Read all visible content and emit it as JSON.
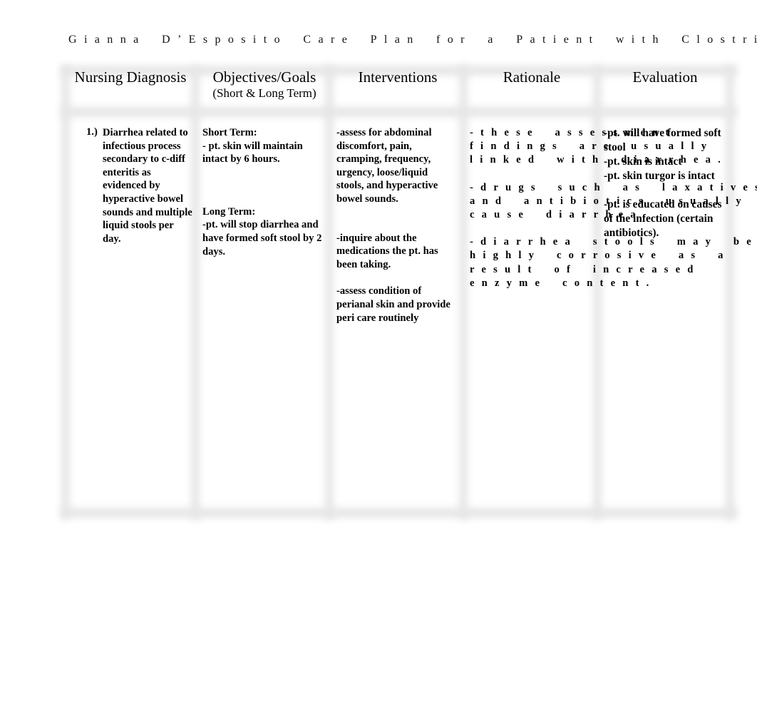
{
  "document": {
    "title": "Gianna D’Esposito Care Plan for a Patient with Clostridium d"
  },
  "table": {
    "headers": {
      "diagnosis": "Nursing Diagnosis",
      "objectives": "Objectives/Goals",
      "objectives_sub": "(Short & Long Term)",
      "interventions": "Interventions",
      "rationale": "Rationale",
      "evaluation": "Evaluation"
    },
    "row1": {
      "number": "1.)",
      "diagnosis": "Diarrhea related to infectious process secondary to c-diff enteritis as evidenced by hyperactive bowel sounds and multiple liquid stools per day.",
      "objectives": {
        "short_label": "Short Term:",
        "short_text": "- pt. skin will maintain intact by 6 hours.",
        "long_label": "Long Term:",
        "long_text": "-pt. will stop diarrhea and have formed soft stool by 2 days."
      },
      "interventions": [
        "-assess for abdominal discomfort, pain, cramping, frequency, urgency, loose/liquid stools, and hyperactive bowel sounds.",
        "-inquire about the medications the pt. has been taking.",
        "-assess condition of perianal skin and provide peri care routinely"
      ],
      "rationale": {
        "r1": [
          "-these assessment",
          "findings are usually",
          "linked with diarrhea."
        ],
        "r2": [
          "-drugs such as laxatives",
          "and antibiotics usually",
          "cause diarrhea."
        ],
        "r3": [
          "-diarrhea stools may be",
          "highly corrosive as a",
          "result of increased",
          "enzyme content."
        ]
      },
      "evaluation": [
        "-pt. will have formed soft stool",
        "-pt. skin is intact",
        "-pt. skin turgor is intact",
        "-pt. is educated on causes of the infection (certain antibiotics)."
      ]
    }
  }
}
